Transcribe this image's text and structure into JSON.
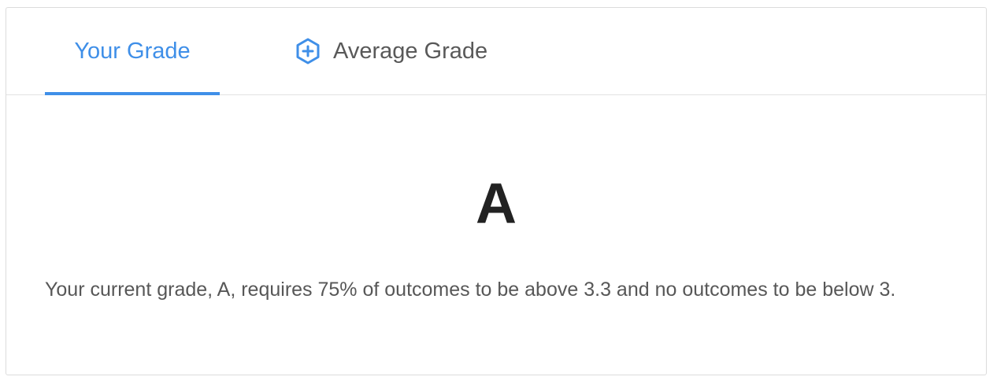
{
  "tabs": {
    "your_grade": "Your Grade",
    "average_grade": "Average Grade",
    "active": "your_grade",
    "average_grade_icon": "hexagon-plus-icon"
  },
  "grade": {
    "letter": "A",
    "description": "Your current grade, A, requires 75% of outcomes to be above 3.3 and no outcomes to be below 3."
  },
  "colors": {
    "accent": "#3f8fe8",
    "text": "#555555",
    "grade_text": "#222222",
    "border": "#dcdcdc"
  }
}
